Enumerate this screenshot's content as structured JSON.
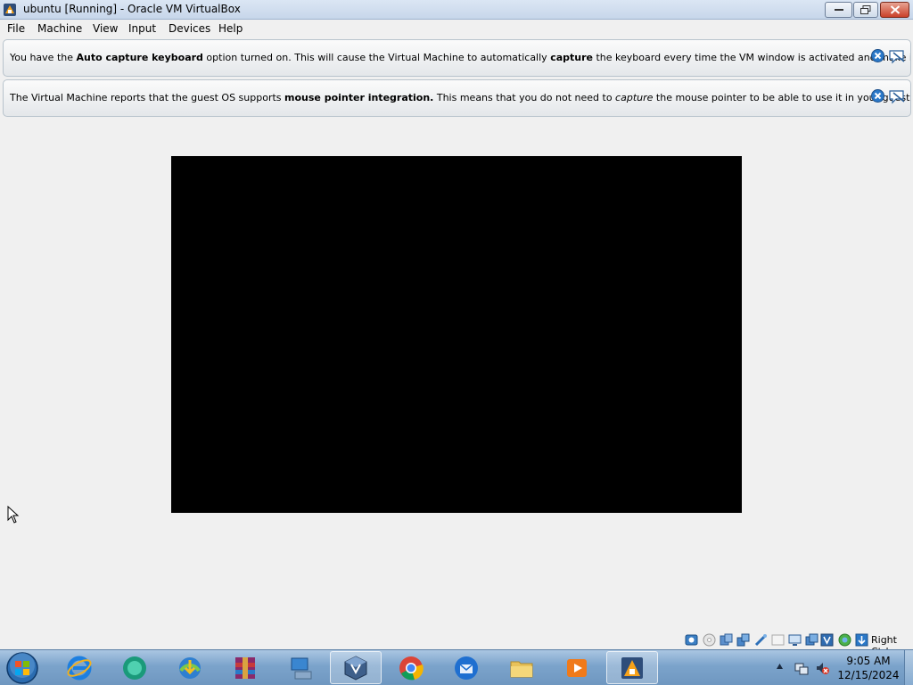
{
  "window": {
    "title": "ubuntu [Running] - Oracle VM VirtualBox",
    "app_icon": "virtualbox-icon"
  },
  "menu": {
    "items": [
      {
        "label": "File"
      },
      {
        "label": "Machine"
      },
      {
        "label": "View"
      },
      {
        "label": "Input"
      },
      {
        "label": "Devices"
      },
      {
        "label": "Help"
      }
    ]
  },
  "banners": [
    {
      "parts": [
        {
          "text": "You have the ",
          "style": "normal"
        },
        {
          "text": "Auto capture keyboard",
          "style": "bold"
        },
        {
          "text": " option turned on. This will cause the Virtual Machine to automatically ",
          "style": "normal"
        },
        {
          "text": "capture",
          "style": "bold"
        },
        {
          "text": " the keyboard every time the VM window is activated and make it unavailable to",
          "style": "normal"
        }
      ]
    },
    {
      "parts": [
        {
          "text": "The Virtual Machine reports that the guest OS supports ",
          "style": "normal"
        },
        {
          "text": "mouse pointer integration.",
          "style": "bold"
        },
        {
          "text": " This means that you do not need to ",
          "style": "normal"
        },
        {
          "text": "capture",
          "style": "italic"
        },
        {
          "text": " the mouse pointer to be able to use it in your guest OS -- all mouse",
          "style": "normal"
        }
      ]
    }
  ],
  "statusbar": {
    "icons": [
      "hard-disk-icon",
      "optical-disk-icon",
      "audio-icon",
      "network-icon",
      "usb-icon",
      "shared-folders-icon",
      "display-icon",
      "video-capture-icon",
      "virtualization-icon",
      "mouse-integration-icon",
      "keyboard-capture-icon"
    ],
    "host_key": "Right Ctrl"
  },
  "taskbar": {
    "apps": [
      "internet-explorer-icon",
      "browser-icon",
      "download-manager-icon",
      "winrar-icon",
      "network-computer-icon",
      "virtualbox-manager-icon",
      "chrome-icon",
      "thunderbird-icon",
      "file-explorer-icon",
      "media-player-icon",
      "virtualbox-vm-icon"
    ],
    "clock": {
      "time": "9:05 AM",
      "date": "12/15/2024"
    }
  },
  "colors": {
    "vm_screen": "#000000",
    "taskbar": "#7ba3cb"
  }
}
